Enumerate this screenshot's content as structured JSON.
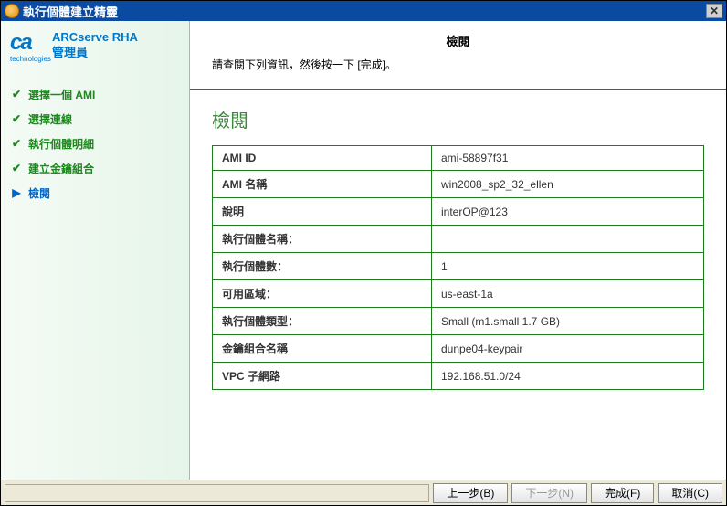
{
  "window": {
    "title": "執行個體建立精靈"
  },
  "brand": {
    "product": "ARCserve RHA",
    "subtitle": "管理員",
    "tech": "technologies"
  },
  "nav": {
    "items": [
      {
        "label": "選擇一個 AMI",
        "state": "done"
      },
      {
        "label": "選擇連線",
        "state": "done"
      },
      {
        "label": "執行個體明細",
        "state": "done"
      },
      {
        "label": "建立金鑰組合",
        "state": "done"
      },
      {
        "label": "檢閱",
        "state": "current"
      }
    ]
  },
  "header": {
    "title": "檢閱",
    "desc": "請查閱下列資訊，然後按一下 [完成]。"
  },
  "content": {
    "heading": "檢閱"
  },
  "review": {
    "rows": [
      {
        "label": "AMI ID",
        "value": "ami-58897f31"
      },
      {
        "label": "AMI 名稱",
        "value": "win2008_sp2_32_ellen"
      },
      {
        "label": "說明",
        "value": "interOP@123"
      },
      {
        "label": "執行個體名稱：",
        "value": ""
      },
      {
        "label": "執行個體數：",
        "value": "1"
      },
      {
        "label": "可用區域：",
        "value": "us-east-1a"
      },
      {
        "label": "執行個體類型：",
        "value": "Small (m1.small 1.7 GB)"
      },
      {
        "label": "金鑰組合名稱",
        "value": "dunpe04-keypair"
      },
      {
        "label": "VPC 子網路",
        "value": "192.168.51.0/24"
      }
    ]
  },
  "footer": {
    "back": "上一步(B)",
    "next": "下一步(N)",
    "finish": "完成(F)",
    "cancel": "取消(C)"
  }
}
